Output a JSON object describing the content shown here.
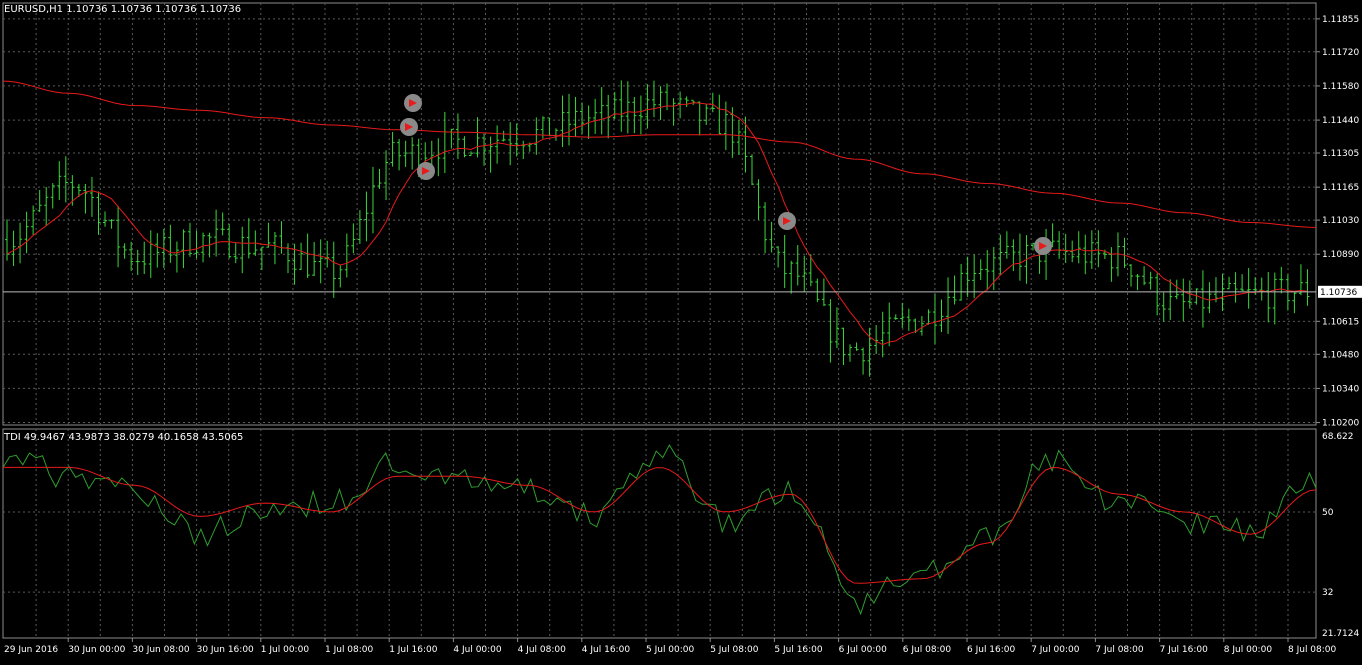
{
  "main_panel": {
    "header": "EURUSD,H1  1.10736 1.10736 1.10736 1.10736",
    "current_price_label": "1.10736",
    "y_ticks": [
      {
        "label": "1.11855",
        "value": 1.11855
      },
      {
        "label": "1.11720",
        "value": 1.1172
      },
      {
        "label": "1.11580",
        "value": 1.1158
      },
      {
        "label": "1.11440",
        "value": 1.1144
      },
      {
        "label": "1.11305",
        "value": 1.11305
      },
      {
        "label": "1.11165",
        "value": 1.11165
      },
      {
        "label": "1.11030",
        "value": 1.1103
      },
      {
        "label": "1.10890",
        "value": 1.1089
      },
      {
        "label": "1.10615",
        "value": 1.10615
      },
      {
        "label": "1.10480",
        "value": 1.1048
      },
      {
        "label": "1.10340",
        "value": 1.1034
      },
      {
        "label": "1.10200",
        "value": 1.102
      }
    ],
    "y_range": [
      1.1019,
      1.1192
    ],
    "current_price": 1.10736
  },
  "indicator_panel": {
    "header": "TDI 49.9467 43.9873 38.0279 40.1658 43.5065",
    "y_ticks": [
      {
        "label": "68.622",
        "value": 68.622
      },
      {
        "label": "50",
        "value": 50
      },
      {
        "label": "32",
        "value": 32
      },
      {
        "label": "21.7124",
        "value": 21.7124
      }
    ],
    "y_range": [
      21.7124,
      68.622
    ]
  },
  "x_axis": {
    "labels": [
      "29 Jun 2016",
      "30 Jun 00:00",
      "30 Jun 08:00",
      "30 Jun 16:00",
      "1 Jul 00:00",
      "1 Jul 08:00",
      "1 Jul 16:00",
      "4 Jul 00:00",
      "4 Jul 08:00",
      "4 Jul 16:00",
      "5 Jul 00:00",
      "5 Jul 08:00",
      "5 Jul 16:00",
      "6 Jul 00:00",
      "6 Jul 08:00",
      "6 Jul 16:00",
      "7 Jul 00:00",
      "7 Jul 08:00",
      "7 Jul 16:00",
      "8 Jul 00:00",
      "8 Jul 08:00"
    ]
  },
  "colors": {
    "background": "#000000",
    "grid": "#5a5a5a",
    "bars": "#39d839",
    "ma": "#e81a1a",
    "tdi_fast": "#2e9e2e",
    "tdi_slow": "#e81a1a",
    "text": "#ffffff",
    "arrow_ring": "#8a8a8a",
    "arrow": "#e81a1a"
  },
  "chart_data": [
    {
      "type": "line",
      "name": "EURUSD,H1",
      "x": [
        "29 Jun 2016",
        "30 Jun 00:00",
        "30 Jun 08:00",
        "30 Jun 16:00",
        "1 Jul 00:00",
        "1 Jul 08:00",
        "1 Jul 16:00",
        "4 Jul 00:00",
        "4 Jul 08:00",
        "4 Jul 16:00",
        "5 Jul 00:00",
        "5 Jul 08:00",
        "5 Jul 16:00",
        "6 Jul 00:00",
        "6 Jul 08:00",
        "6 Jul 16:00",
        "7 Jul 00:00",
        "7 Jul 08:00",
        "7 Jul 16:00",
        "8 Jul 00:00",
        "8 Jul 08:00"
      ],
      "ohlc_close_samples": [
        1.1095,
        1.1118,
        1.1088,
        1.1095,
        1.1092,
        1.1082,
        1.113,
        1.1135,
        1.1138,
        1.1145,
        1.1151,
        1.1143,
        1.1082,
        1.105,
        1.1062,
        1.1085,
        1.109,
        1.1088,
        1.1068,
        1.1072,
        1.1074
      ],
      "ma_long": [
        1.116,
        1.1155,
        1.115,
        1.1148,
        1.1145,
        1.1142,
        1.114,
        1.1139,
        1.1138,
        1.1137,
        1.1138,
        1.1138,
        1.1135,
        1.1128,
        1.1122,
        1.1118,
        1.1114,
        1.111,
        1.1106,
        1.1102,
        1.11
      ],
      "ylim": [
        1.1019,
        1.1192
      ]
    },
    {
      "type": "line",
      "name": "TDI",
      "x": [
        "29 Jun 2016",
        "30 Jun 00:00",
        "30 Jun 08:00",
        "30 Jun 16:00",
        "1 Jul 00:00",
        "1 Jul 08:00",
        "1 Jul 16:00",
        "4 Jul 00:00",
        "4 Jul 08:00",
        "4 Jul 16:00",
        "5 Jul 00:00",
        "5 Jul 08:00",
        "5 Jul 16:00",
        "6 Jul 00:00",
        "6 Jul 08:00",
        "6 Jul 16:00",
        "7 Jul 00:00",
        "7 Jul 08:00",
        "7 Jul 16:00",
        "8 Jul 00:00",
        "8 Jul 08:00"
      ],
      "series": [
        {
          "name": "fast",
          "values": [
            63,
            58,
            55,
            45,
            50,
            52,
            61,
            57,
            55,
            49,
            63,
            48,
            55,
            30,
            36,
            44,
            62,
            52,
            48,
            46,
            57
          ]
        },
        {
          "name": "slow",
          "values": [
            60,
            60,
            56,
            49,
            52,
            50,
            58,
            58,
            56,
            50,
            60,
            50,
            54,
            34,
            35,
            43,
            60,
            54,
            50,
            45,
            55
          ]
        }
      ],
      "ylim": [
        21.7124,
        68.622
      ]
    }
  ]
}
